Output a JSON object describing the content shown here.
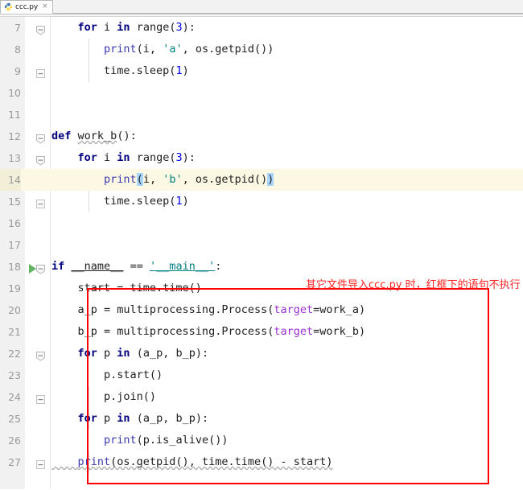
{
  "window": {
    "tab": {
      "icon": "python-file-icon",
      "label": "ccc.py",
      "close": "×"
    }
  },
  "editor": {
    "current_line": 14,
    "run_marker_line": 18,
    "colors": {
      "keyword": "#00007f",
      "string": "#008080",
      "number": "#0000ee",
      "kwarg": "#9b30d0",
      "print_fn": "#3a3ab0",
      "current_line_bg": "#fdf8e3",
      "bracket_match_bg": "#a8d4fb",
      "gutter_bg": "#f1f1f1",
      "line_number": "#999999",
      "annotation": "#ff2222",
      "redbox": "#ff0000"
    },
    "lines": [
      {
        "n": "7",
        "text": "    for i in range(3):"
      },
      {
        "n": "8",
        "text": "        print(i, 'a', os.getpid())"
      },
      {
        "n": "9",
        "text": "        time.sleep(1)"
      },
      {
        "n": "10",
        "text": ""
      },
      {
        "n": "11",
        "text": ""
      },
      {
        "n": "12",
        "text": "def work_b():"
      },
      {
        "n": "13",
        "text": "    for i in range(3):"
      },
      {
        "n": "14",
        "text": "        print(i, 'b', os.getpid())"
      },
      {
        "n": "15",
        "text": "        time.sleep(1)"
      },
      {
        "n": "16",
        "text": ""
      },
      {
        "n": "17",
        "text": ""
      },
      {
        "n": "18",
        "text": "if __name__ == '__main__':"
      },
      {
        "n": "19",
        "text": "    start = time.time()"
      },
      {
        "n": "20",
        "text": "    a_p = multiprocessing.Process(target=work_a)"
      },
      {
        "n": "21",
        "text": "    b_p = multiprocessing.Process(target=work_b)"
      },
      {
        "n": "22",
        "text": "    for p in (a_p, b_p):"
      },
      {
        "n": "23",
        "text": "        p.start()"
      },
      {
        "n": "24",
        "text": "        p.join()"
      },
      {
        "n": "25",
        "text": "    for p in (a_p, b_p):"
      },
      {
        "n": "26",
        "text": "        print(p.is_alive())"
      },
      {
        "n": "27",
        "text": "    print(os.getpid(), time.time() - start)"
      }
    ]
  },
  "annotation": {
    "text": "其它文件导入ccc.py 时，红框下的语句不执行"
  }
}
